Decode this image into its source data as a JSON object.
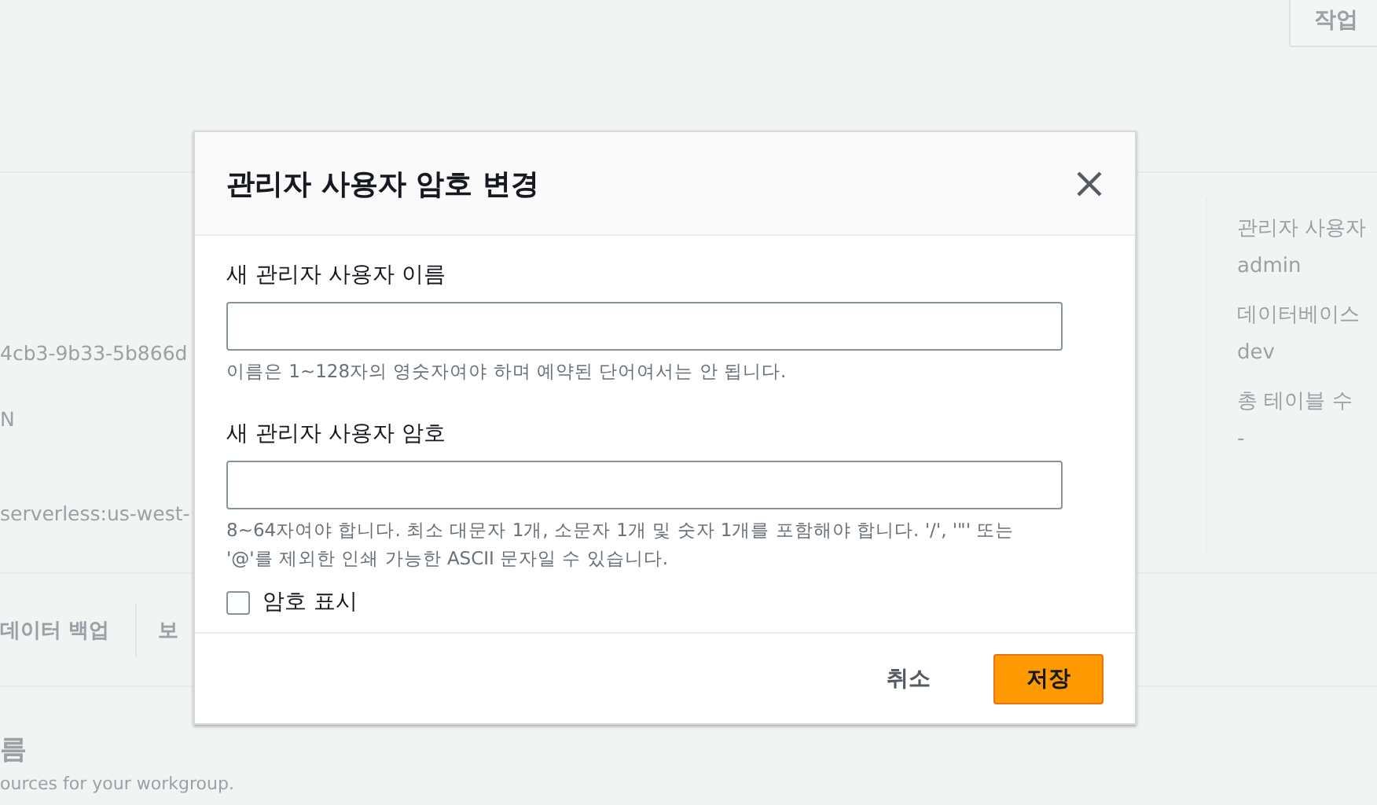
{
  "background": {
    "actions_button": "작업",
    "details_left": [
      "4cb3-9b33-5b866d",
      "N",
      "serverless:us-west-"
    ],
    "details_right": [
      {
        "label": "관리자 사용자",
        "value": "admin"
      },
      {
        "label": "데이터베이스",
        "value": "dev"
      },
      {
        "label": "총 테이블 수",
        "value": "-"
      }
    ],
    "tabs": [
      "데이터 백업",
      "보"
    ],
    "section_title": "름",
    "section_description": "ources for your workgroup."
  },
  "dialog": {
    "title": "관리자 사용자 암호 변경",
    "fields": [
      {
        "label": "새 관리자 사용자 이름",
        "hint": "이름은 1~128자의 영숫자여야 하며 예약된 단어여서는 안 됩니다."
      },
      {
        "label": "새 관리자 사용자 암호",
        "hint": "8~64자여야 합니다. 최소 대문자 1개, 소문자 1개 및 숫자 1개를 포함해야 합니다. '/', '\"' 또는 '@'를 제외한 인쇄 가능한 ASCII 문자일 수 있습니다."
      }
    ],
    "checkbox": {
      "label": "암호 표시",
      "checked": false
    },
    "buttons": [
      {
        "label": "취소",
        "kind": "link"
      },
      {
        "label": "저장",
        "kind": "primary"
      }
    ]
  }
}
